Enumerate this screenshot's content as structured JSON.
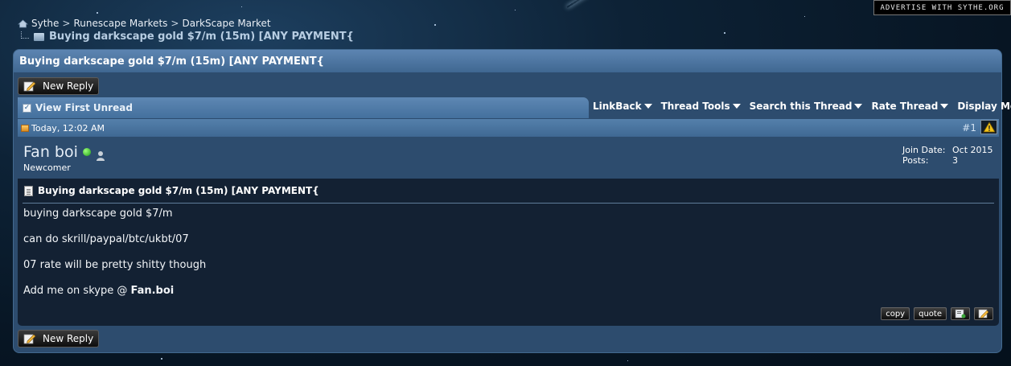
{
  "banner": {
    "advertise": "ADVERTISE WITH SYTHE.ORG"
  },
  "breadcrumb": {
    "items": [
      "Sythe",
      "Runescape Markets",
      "DarkScape Market"
    ],
    "separator": ">",
    "current": "Buying darkscape gold $7/m (15m) [ANY PAYMENT{"
  },
  "thread": {
    "title": "Buying darkscape gold $7/m (15m) [ANY PAYMENT{",
    "new_reply": "New Reply",
    "view_first_unread": "View First Unread",
    "tools": [
      "LinkBack",
      "Thread Tools",
      "Search this Thread",
      "Rate Thread",
      "Display Modes"
    ]
  },
  "post": {
    "date": "Today, 12:02 AM",
    "number": "#1",
    "username": "Fan boi",
    "rank": "Newcomer",
    "join_date_label": "Join Date:",
    "join_date": "Oct 2015",
    "posts_label": "Posts:",
    "posts": "3",
    "title": "Buying darkscape gold $7/m (15m) [ANY PAYMENT{",
    "lines": [
      "buying darkscape gold $7/m",
      "can do skrill/paypal/btc/ukbt/07",
      "07 rate will be pretty shitty though"
    ],
    "last_line_prefix": "Add me on skype @ ",
    "last_line_bold": "Fan.boi",
    "copy_label": "copy",
    "quote_label": "quote"
  },
  "colors": {
    "panel": "#2d4c6e",
    "header": "#5d85b2",
    "post_body": "#132133"
  }
}
